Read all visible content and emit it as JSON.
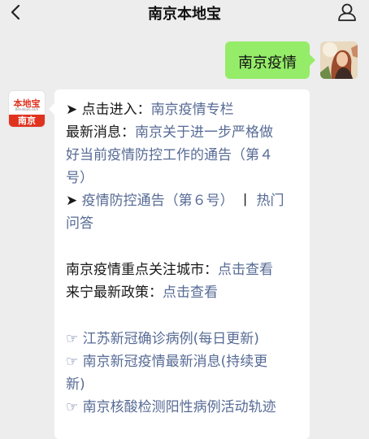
{
  "header": {
    "title": "南京本地宝"
  },
  "outgoing": {
    "text": "南京疫情"
  },
  "bot": {
    "logo_text": "本地宝",
    "domain_text": "Bendibao.com",
    "city_tag": "南京"
  },
  "message": {
    "row1_arrow": "➤",
    "row1_label": "点击进入：",
    "row1_link": "南京疫情专栏",
    "row2_label": "最新消息：",
    "row2_link_a": "南京关于进一步严格做",
    "row3_link_b": "好当前疫情防控工作的通告（第４",
    "row4_link_c": "号）",
    "row5_arrow": "➤",
    "row5_link": "疫情防控通告（第６号）",
    "row5_sep": "丨",
    "row5_link2": "热门",
    "row6_link2b": "问答",
    "row8_label": "南京疫情重点关注城市：",
    "row8_link": "点击查看",
    "row9_label": "来宁最新政策：",
    "row9_link": "点击查看",
    "row11_link": "☞ 江苏新冠确诊病例(每日更新)",
    "row12_link": "☞ 南京新冠疫情最新消息(持续更",
    "row13_link": "新)",
    "row14_link": "☞ 南京核酸检测阳性病例活动轨迹"
  }
}
